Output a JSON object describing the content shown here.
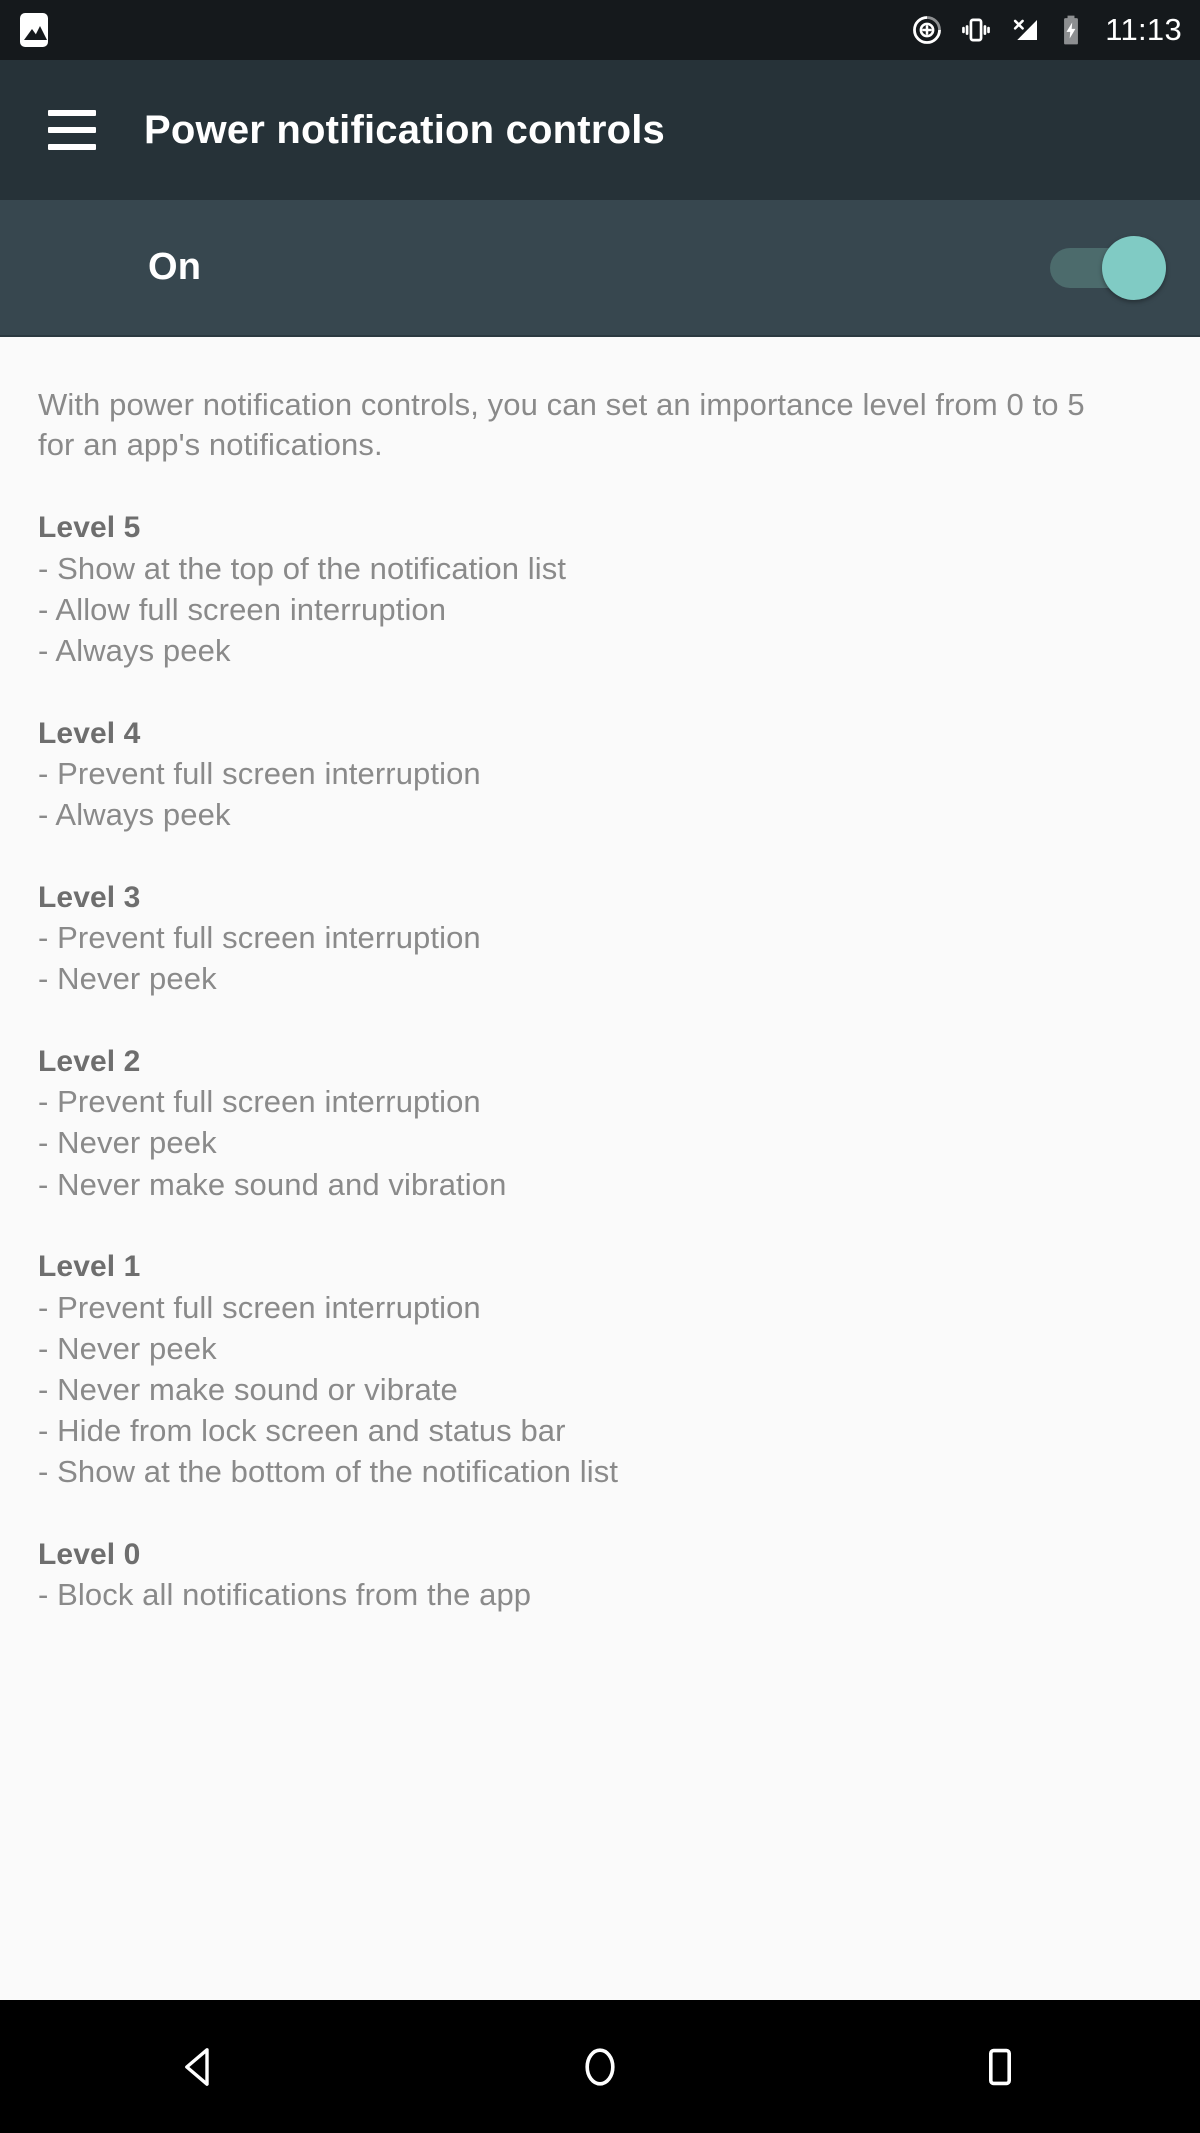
{
  "status_bar": {
    "left_icons": [
      {
        "name": "screenshot-icon",
        "label": "screenshot"
      }
    ],
    "right_icons": [
      {
        "name": "priority-dnd-icon",
        "label": "do-not-disturb-priority"
      },
      {
        "name": "vibrate-icon",
        "label": "vibrate"
      },
      {
        "name": "no-signal-icon",
        "label": "no-sim-signal"
      },
      {
        "name": "battery-charging-icon",
        "label": "battery-charging"
      }
    ],
    "time": "11:13",
    "background_color": "#15191c"
  },
  "toolbar": {
    "menu_icon": "hamburger-menu-icon",
    "title": "Power notification controls",
    "background_color": "#263238"
  },
  "switch_bar": {
    "label": "On",
    "state": "on",
    "thumb_color": "#80cbc4",
    "track_color": "#4c6b6c",
    "background_color": "#37474f"
  },
  "content": {
    "intro": "With power notification controls, you can set an importance level from 0 to 5 for an app's notifications.",
    "levels": [
      {
        "title": "Level 5",
        "items": [
          "- Show at the top of the notification list",
          "- Allow full screen interruption",
          "- Always peek"
        ]
      },
      {
        "title": "Level 4",
        "items": [
          "- Prevent full screen interruption",
          "- Always peek"
        ]
      },
      {
        "title": "Level 3",
        "items": [
          "- Prevent full screen interruption",
          "- Never peek"
        ]
      },
      {
        "title": "Level 2",
        "items": [
          "- Prevent full screen interruption",
          "- Never peek",
          "- Never make sound and vibration"
        ]
      },
      {
        "title": "Level 1",
        "items": [
          "- Prevent full screen interruption",
          "- Never peek",
          "- Never make sound or vibrate",
          "- Hide from lock screen and status bar",
          "- Show at the bottom of the notification list"
        ]
      },
      {
        "title": "Level 0",
        "items": [
          "- Block all notifications from the app"
        ]
      }
    ],
    "background_color": "#fafafa",
    "text_color": "#8a8a8a",
    "heading_color": "#6e6e6e"
  },
  "nav_bar": {
    "buttons": [
      {
        "name": "back-button",
        "icon": "back-triangle-icon"
      },
      {
        "name": "home-button",
        "icon": "home-circle-icon"
      },
      {
        "name": "recents-button",
        "icon": "recents-square-icon"
      }
    ],
    "background_color": "#000000"
  }
}
